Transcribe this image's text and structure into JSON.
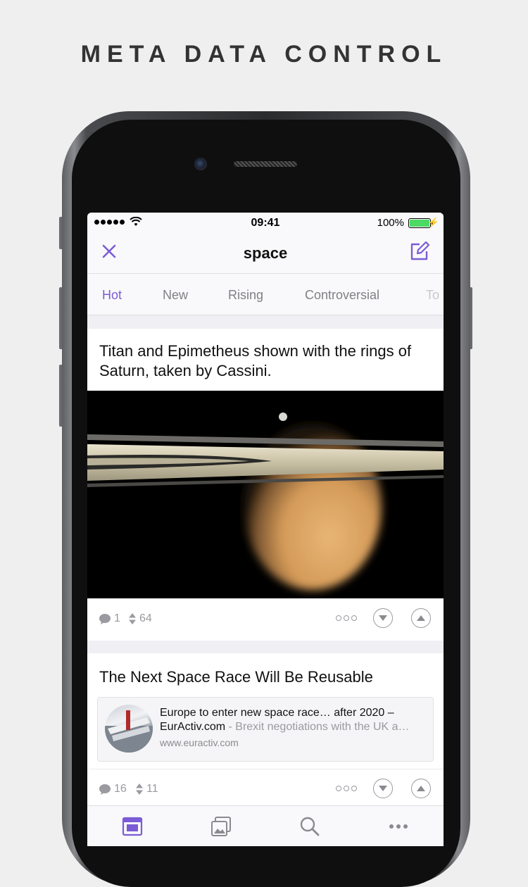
{
  "headline": "META DATA CONTROL",
  "colors": {
    "accent": "#7b5cd6",
    "battery": "#4cd964",
    "muted": "#9a9aa0"
  },
  "status_bar": {
    "time": "09:41",
    "battery_percent": "100%"
  },
  "nav": {
    "title": "space",
    "close_icon": "close-icon",
    "compose_icon": "compose-icon"
  },
  "tabs": [
    {
      "label": "Hot",
      "active": true
    },
    {
      "label": "New",
      "active": false
    },
    {
      "label": "Rising",
      "active": false
    },
    {
      "label": "Controversial",
      "active": false
    },
    {
      "label": "To",
      "active": false
    }
  ],
  "posts": [
    {
      "title": "Titan and Epimetheus shown with the rings of Saturn, taken by Cassini.",
      "comments": "1",
      "score": "64"
    },
    {
      "title": "The Next Space Race Will Be Reusable",
      "link": {
        "headline": "Europe to enter new space race… after 2020 –",
        "source": "EurActiv.com",
        "description": " - Brexit negotiations with the UK a…",
        "domain": "www.euractiv.com"
      },
      "comments": "16",
      "score": "11"
    }
  ],
  "tab_bar": [
    "feed-icon",
    "gallery-icon",
    "search-icon",
    "more-icon"
  ]
}
